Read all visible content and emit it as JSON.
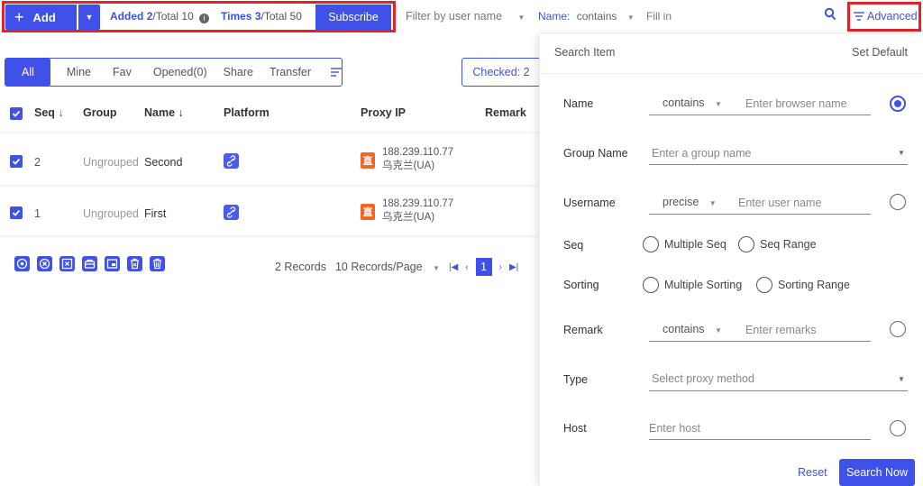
{
  "toolbar": {
    "add_label": "Add",
    "added_label": "Added",
    "added_value": "2",
    "added_total": "/Total 10",
    "times_label": "Times",
    "times_value": "3",
    "times_total": "/Total 50",
    "subscribe_label": "Subscribe",
    "filter_placeholder": "Filter by user name",
    "name_filter_label": "Name",
    "name_filter_sep": ":",
    "name_filter_op": "contains",
    "name_filter_placeholder": "Fill in",
    "advanced_label": "Advanced"
  },
  "tabs": [
    "All",
    "Mine",
    "Fav",
    "Opened(0)",
    "Share",
    "Transfer"
  ],
  "checked_label": "Checked: 2",
  "table": {
    "headers": {
      "seq": "Seq",
      "group": "Group",
      "name": "Name",
      "platform": "Platform",
      "proxy_ip": "Proxy IP",
      "remark": "Remark"
    },
    "rows": [
      {
        "seq": "2",
        "group": "Ungrouped",
        "name": "Second",
        "ip_badge": "直",
        "ip": "188.239.110.77",
        "region": "乌克兰(UA)"
      },
      {
        "seq": "1",
        "group": "Ungrouped",
        "name": "First",
        "ip_badge": "直",
        "ip": "188.239.110.77",
        "region": "乌克兰(UA)"
      }
    ]
  },
  "pager": {
    "records": "2 Records",
    "per_page": "10 Records/Page",
    "current": "1"
  },
  "panel": {
    "title": "Search Item",
    "set_default": "Set Default",
    "fields": {
      "name_label": "Name",
      "name_op": "contains",
      "name_placeholder": "Enter browser name",
      "group_label": "Group Name",
      "group_placeholder": "Enter a group name",
      "username_label": "Username",
      "username_op": "precise",
      "username_placeholder": "Enter user name",
      "seq_label": "Seq",
      "seq_opt1": "Multiple Seq",
      "seq_opt2": "Seq Range",
      "sorting_label": "Sorting",
      "sorting_opt1": "Multiple Sorting",
      "sorting_opt2": "Sorting Range",
      "remark_label": "Remark",
      "remark_op": "contains",
      "remark_placeholder": "Enter remarks",
      "type_label": "Type",
      "type_placeholder": "Select proxy method",
      "host_label": "Host",
      "host_placeholder": "Enter host"
    },
    "reset_label": "Reset",
    "search_label": "Search Now"
  },
  "colors": {
    "accent": "#3f51e8",
    "highlight": "#e0242b",
    "ip_badge": "#f26522"
  }
}
